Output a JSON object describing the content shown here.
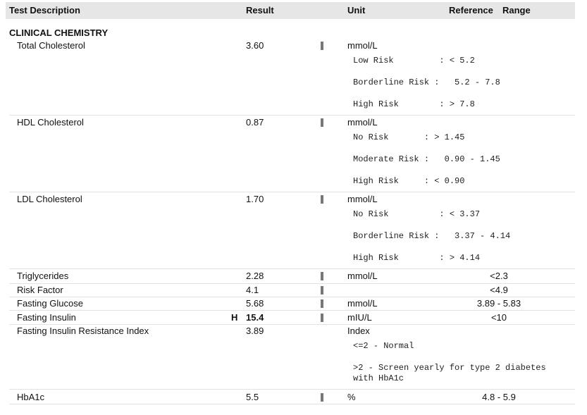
{
  "header": {
    "test_description": "Test Description",
    "result": "Result",
    "unit": "Unit",
    "reference": "Reference",
    "range": "Range"
  },
  "section": {
    "title": "CLINICAL CHEMISTRY"
  },
  "tests": [
    {
      "name": "Total Cholesterol",
      "flag": "",
      "result": "3.60",
      "unit": "mmol/L",
      "ref": "",
      "notes": [
        "Low Risk         : < 5.2",
        "Borderline Risk :   5.2 - 7.8",
        "High Risk        : > 7.8"
      ]
    },
    {
      "name": "HDL Cholesterol",
      "flag": "",
      "result": "0.87",
      "unit": "mmol/L",
      "ref": "",
      "notes": [
        "No Risk       : > 1.45",
        "Moderate Risk :   0.90 - 1.45",
        "High Risk     : < 0.90"
      ]
    },
    {
      "name": "LDL Cholesterol",
      "flag": "",
      "result": "1.70",
      "unit": "mmol/L",
      "ref": "",
      "notes": [
        "No Risk          : < 3.37",
        "Borderline Risk :   3.37 - 4.14",
        "High Risk        : > 4.14"
      ]
    },
    {
      "name": "Triglycerides",
      "flag": "",
      "result": "2.28",
      "unit": "mmol/L",
      "ref": "<2.3"
    },
    {
      "name": "Risk Factor",
      "flag": "",
      "result": "4.1",
      "unit": "",
      "ref": "<4.9"
    },
    {
      "name": "Fasting Glucose",
      "flag": "",
      "result": "5.68",
      "unit": "mmol/L",
      "ref": "3.89 - 5.83"
    },
    {
      "name": "Fasting Insulin",
      "flag": "H",
      "result": "15.4",
      "unit": "mIU/L",
      "ref": "<10"
    },
    {
      "name": "Fasting Insulin Resistance Index",
      "flag": "",
      "result": "3.89",
      "unit": "Index",
      "ref": "",
      "notes": [
        "<=2 - Normal",
        ">2 - Screen yearly for type 2 diabetes",
        "with HbA1c"
      ]
    },
    {
      "name": "HbA1c",
      "flag": "",
      "result": "5.5",
      "unit": "%",
      "ref": "4.8 - 5.9"
    }
  ]
}
